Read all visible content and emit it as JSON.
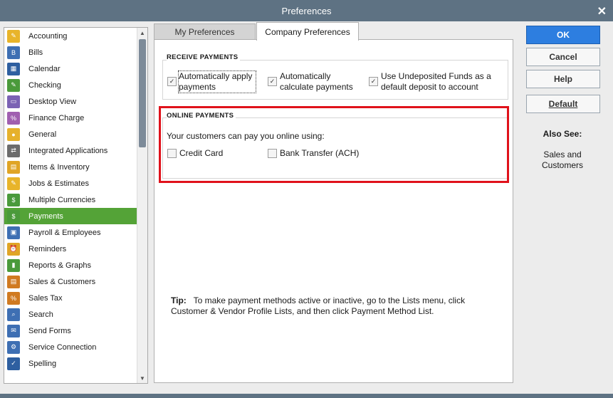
{
  "window": {
    "title": "Preferences",
    "close_glyph": "✕"
  },
  "categories": [
    {
      "label": "Accounting",
      "icon": "accounting-icon",
      "color": "#e8b42a",
      "glyph": "✎"
    },
    {
      "label": "Bills",
      "icon": "bills-icon",
      "color": "#3e6fb3",
      "glyph": "B"
    },
    {
      "label": "Calendar",
      "icon": "calendar-icon",
      "color": "#2e5fa0",
      "glyph": "▦"
    },
    {
      "label": "Checking",
      "icon": "checking-icon",
      "color": "#4a9a3b",
      "glyph": "✎"
    },
    {
      "label": "Desktop View",
      "icon": "desktop-view-icon",
      "color": "#7b62b4",
      "glyph": "▭"
    },
    {
      "label": "Finance Charge",
      "icon": "finance-charge-icon",
      "color": "#a05fb0",
      "glyph": "%"
    },
    {
      "label": "General",
      "icon": "general-icon",
      "color": "#e6b12c",
      "glyph": "●"
    },
    {
      "label": "Integrated Applications",
      "icon": "integrated-applications-icon",
      "color": "#6c6c6c",
      "glyph": "⇄"
    },
    {
      "label": "Items & Inventory",
      "icon": "items-inventory-icon",
      "color": "#e0a526",
      "glyph": "▤"
    },
    {
      "label": "Jobs & Estimates",
      "icon": "jobs-estimates-icon",
      "color": "#e8b42a",
      "glyph": "✎"
    },
    {
      "label": "Multiple Currencies",
      "icon": "multiple-currencies-icon",
      "color": "#4a9a3b",
      "glyph": "$"
    },
    {
      "label": "Payments",
      "icon": "payments-icon",
      "color": "#4a9a3b",
      "glyph": "$"
    },
    {
      "label": "Payroll & Employees",
      "icon": "payroll-employees-icon",
      "color": "#3e6fb3",
      "glyph": "▣"
    },
    {
      "label": "Reminders",
      "icon": "reminders-icon",
      "color": "#e0a526",
      "glyph": "⏰"
    },
    {
      "label": "Reports & Graphs",
      "icon": "reports-graphs-icon",
      "color": "#4a9a3b",
      "glyph": "▮"
    },
    {
      "label": "Sales & Customers",
      "icon": "sales-customers-icon",
      "color": "#d07a21",
      "glyph": "▤"
    },
    {
      "label": "Sales Tax",
      "icon": "sales-tax-icon",
      "color": "#d07a21",
      "glyph": "%"
    },
    {
      "label": "Search",
      "icon": "search-icon",
      "color": "#3e6fb3",
      "glyph": "⌕"
    },
    {
      "label": "Send Forms",
      "icon": "send-forms-icon",
      "color": "#3e6fb3",
      "glyph": "✉"
    },
    {
      "label": "Service Connection",
      "icon": "service-connection-icon",
      "color": "#3e6fb3",
      "glyph": "⚙"
    },
    {
      "label": "Spelling",
      "icon": "spelling-icon",
      "color": "#2e5fa0",
      "glyph": "✓"
    }
  ],
  "selected_category": "Payments",
  "tabs": {
    "my_preferences": "My Preferences",
    "company_preferences": "Company Preferences"
  },
  "receive_payments": {
    "title": "RECEIVE PAYMENTS",
    "options": [
      {
        "label_line1": "Automatically apply",
        "label_line2": "payments",
        "checked": true
      },
      {
        "label_line1": "Automatically",
        "label_line2": "calculate payments",
        "checked": true
      },
      {
        "label_line1": "Use Undeposited Funds as a",
        "label_line2": "default deposit to account",
        "checked": true
      }
    ]
  },
  "online_payments": {
    "title": "ONLINE PAYMENTS",
    "intro": "Your customers can pay you online using:",
    "options": [
      {
        "label": "Credit Card",
        "checked": false
      },
      {
        "label": "Bank Transfer (ACH)",
        "checked": false
      }
    ]
  },
  "tip": {
    "label": "Tip:",
    "line1": "To make payment methods active or inactive, go to the Lists menu, click",
    "line2": "Customer & Vendor Profile Lists, and then click Payment Method List."
  },
  "buttons": {
    "ok": "OK",
    "cancel": "Cancel",
    "help": "Help",
    "default": "Default"
  },
  "also_see": {
    "title": "Also See:",
    "line1": "Sales and",
    "line2": "Customers"
  },
  "colors": {
    "title_bar": "#5e7283",
    "selected": "#54a337",
    "ok_button": "#2d7ee0",
    "highlight_frame": "#e0121b"
  }
}
